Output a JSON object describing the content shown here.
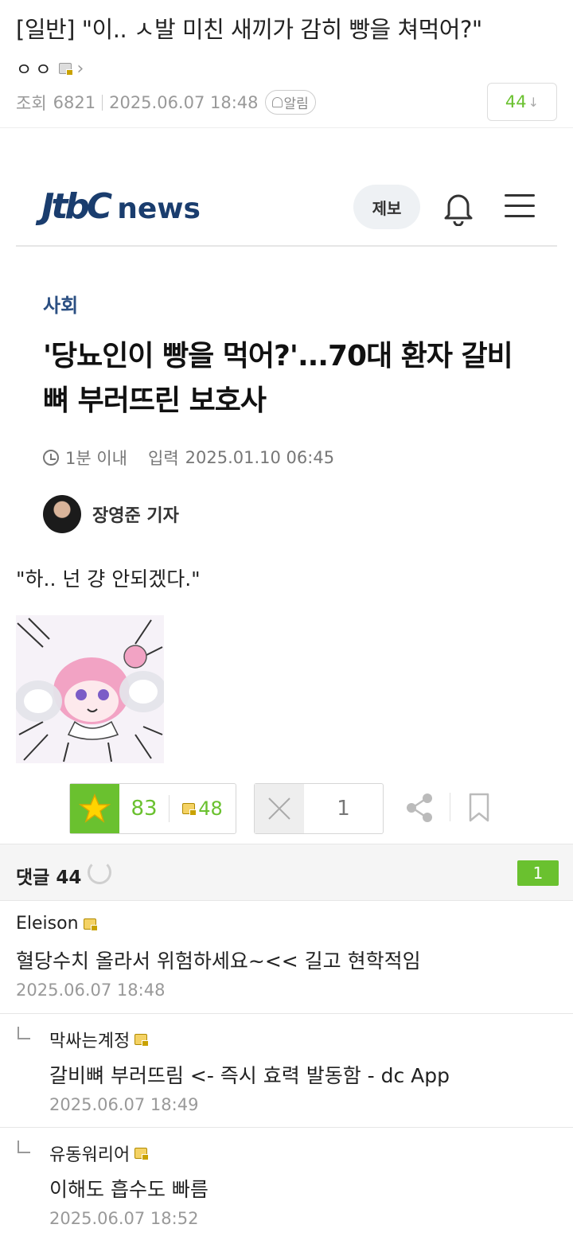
{
  "post": {
    "title": "[일반] \"이.. ㅅ발 미친 새끼가 감히 빵을 쳐먹어?\"",
    "author": "ㅇㅇ",
    "views_label": "조회",
    "views": "6821",
    "datetime": "2025.06.07 18:48",
    "alarm_label": "알림",
    "comment_count": "44",
    "comment_arrow": "↓"
  },
  "article": {
    "logo_mark": "JtbC",
    "logo_word": "news",
    "jebo_label": "제보",
    "section": "사회",
    "headline": "'당뇨인이 빵을 먹어?'...70대 환자 갈비뼈 부러뜨린 보호사",
    "read_time": "1분 이내",
    "published_label": "입력",
    "published": "2025.01.10 06:45",
    "reporter": "장영준 기자"
  },
  "body": {
    "quote": "\"하.. 넌 걍 안되겠다.\""
  },
  "votes": {
    "recommend": "83",
    "fixed_recommend": "48",
    "not_recommend": "1"
  },
  "comments_header": {
    "label": "댓글",
    "count": "44",
    "new_count": "1"
  },
  "comments": [
    {
      "nick": "Eleison",
      "text": "혈당수치 올라서 위험하세요~<< 길고 현학적임",
      "date": "2025.06.07 18:48",
      "reply": false
    },
    {
      "nick": "막싸는계정",
      "text": "갈비뼈 부러뜨림 <- 즉시 효력 발동함 - dc App",
      "date": "2025.06.07 18:49",
      "reply": true
    },
    {
      "nick": "유동워리어",
      "text": "이해도 흡수도 빠름",
      "date": "2025.06.07 18:52",
      "reply": true
    }
  ],
  "colors": {
    "accent_green": "#6ac12f",
    "jtbc_navy": "#1a3d6e",
    "muted_text": "#999999"
  }
}
